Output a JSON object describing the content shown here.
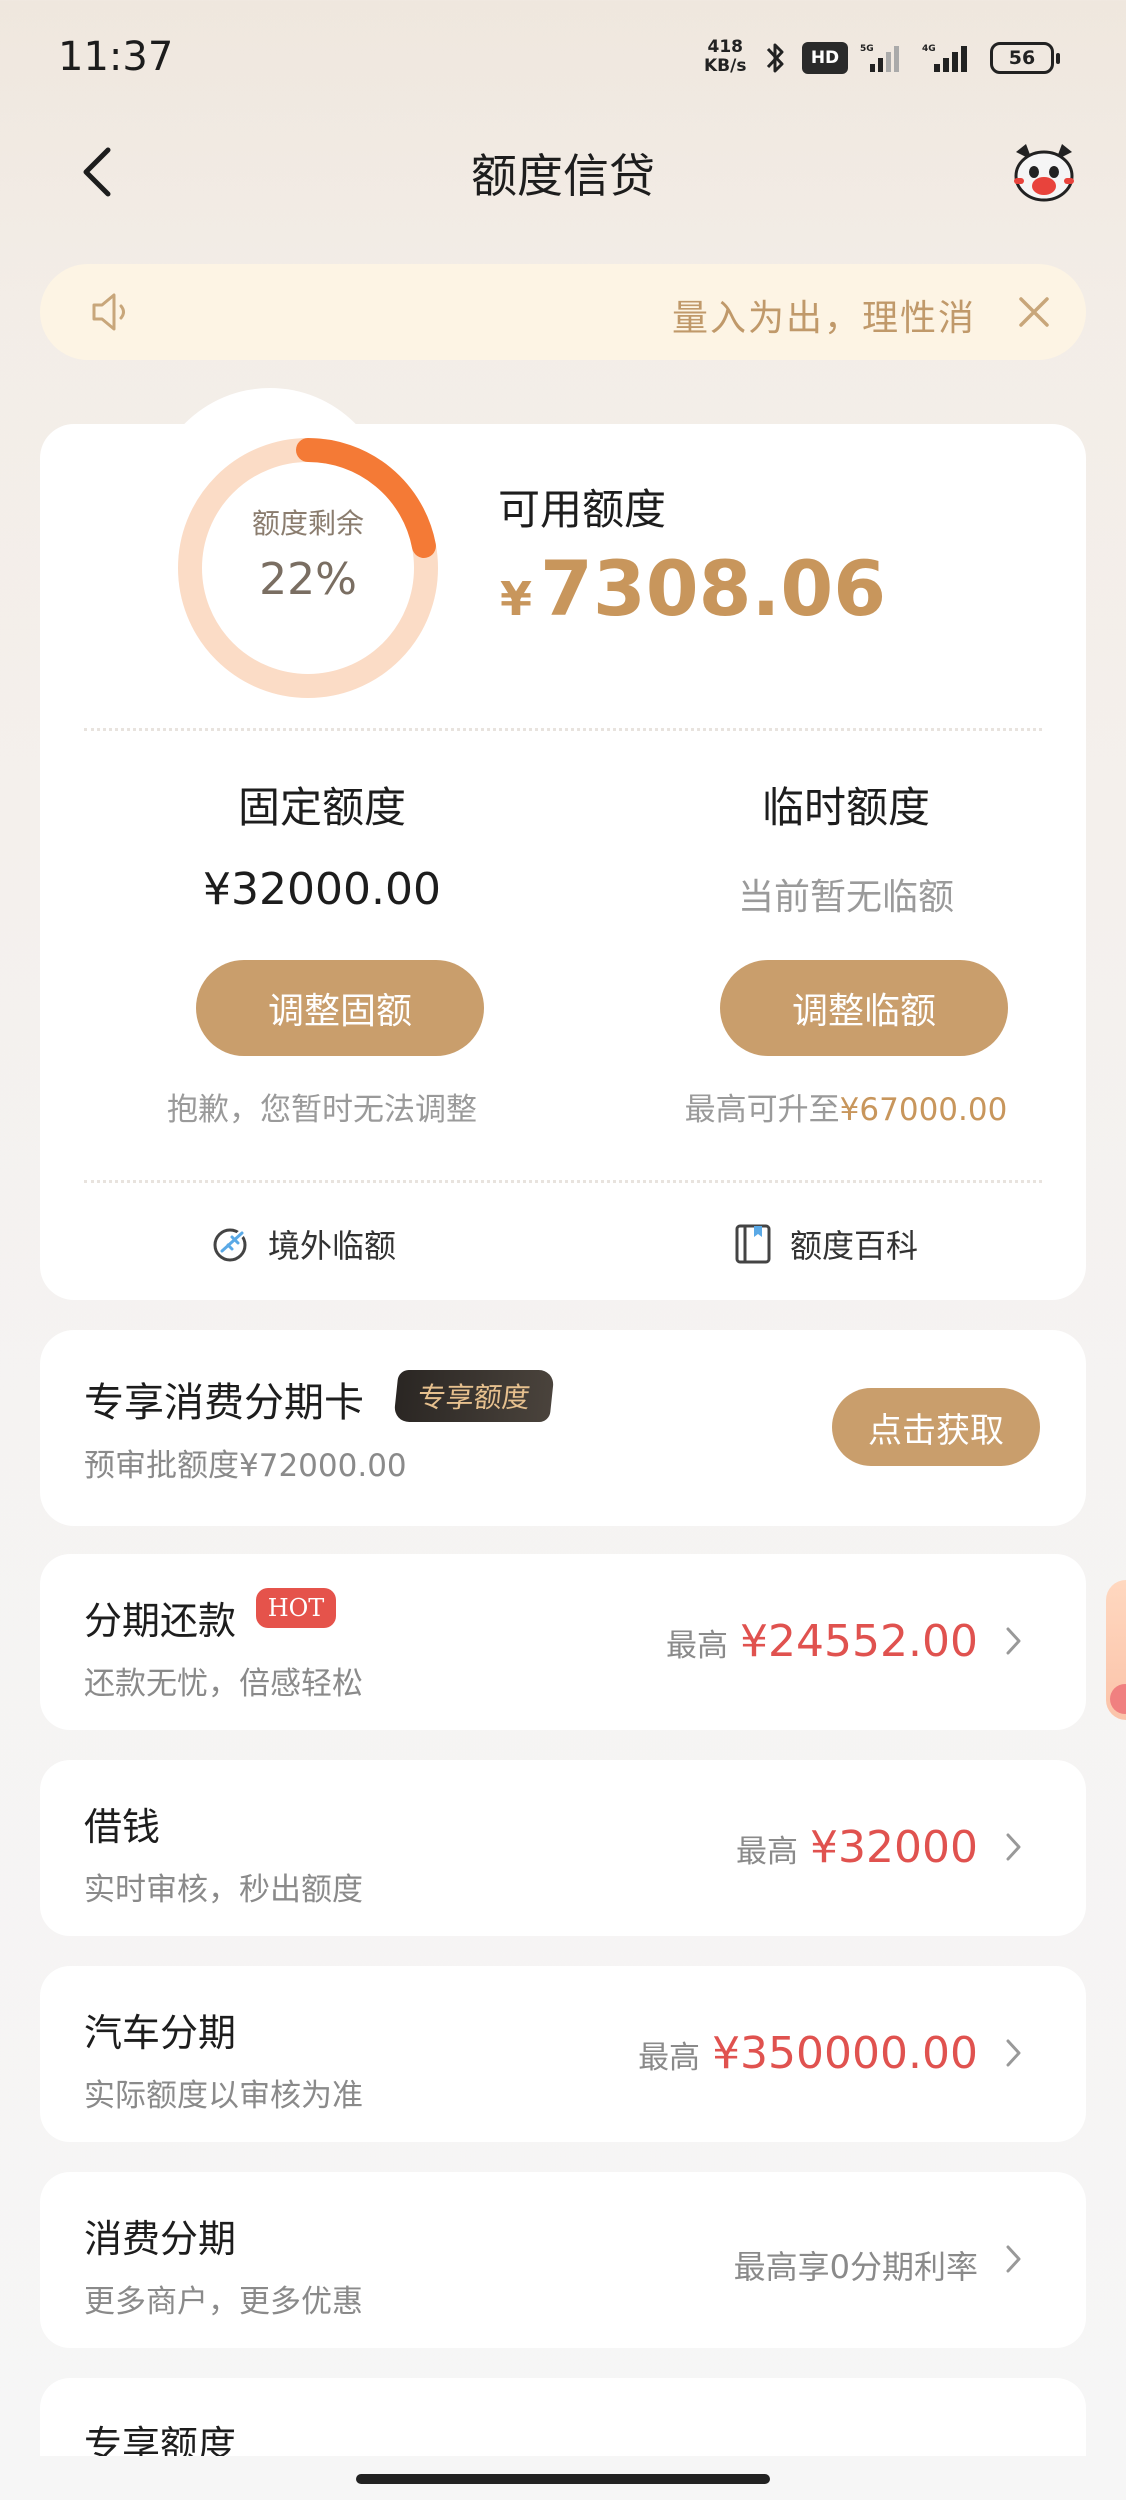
{
  "status_bar": {
    "time": "11:37",
    "net_speed_value": "418",
    "net_speed_unit": "KB/s",
    "hd_label": "HD",
    "battery": "56"
  },
  "nav": {
    "title": "额度信贷"
  },
  "notice": {
    "text": "量入为出，理性消"
  },
  "quota": {
    "ring_label": "额度剩余",
    "ring_value": "22%",
    "remaining_ratio": 0.22,
    "available_label": "可用额度",
    "currency": "¥",
    "available_amount": "7308.06",
    "fixed": {
      "title": "固定额度",
      "value": "¥32000.00",
      "button": "调整固额",
      "note": "抱歉，您暂时无法调整"
    },
    "temporary": {
      "title": "临时额度",
      "value": "当前暂无临额",
      "button": "调整临额",
      "note_prefix": "最高可升至",
      "note_amount": "¥67000.00"
    },
    "overseas_label": "境外临额",
    "wiki_label": "额度百科"
  },
  "promo": {
    "title": "专享消费分期卡",
    "badge": "专享额度",
    "subtitle": "预审批额度¥72000.00",
    "button": "点击获取"
  },
  "list": [
    {
      "title": "分期还款",
      "tag": "HOT",
      "subtitle": "还款无忧，倍感轻松",
      "prefix": "最高",
      "amount": "¥24552.00"
    },
    {
      "title": "借钱",
      "subtitle": "实时审核，秒出额度",
      "prefix": "最高",
      "amount": "¥32000"
    },
    {
      "title": "汽车分期",
      "subtitle": "实际额度以审核为准",
      "prefix": "最高",
      "amount": "¥350000.00"
    },
    {
      "title": "消费分期",
      "subtitle": "更多商户，更多优惠",
      "plain": "最高享0分期利率"
    },
    {
      "title": "专享额度"
    }
  ],
  "colors": {
    "accent_gold": "#c99e6c",
    "amount_red": "#e0524f",
    "ring_orange": "#f47a36",
    "ring_track": "#fbdcc6"
  }
}
